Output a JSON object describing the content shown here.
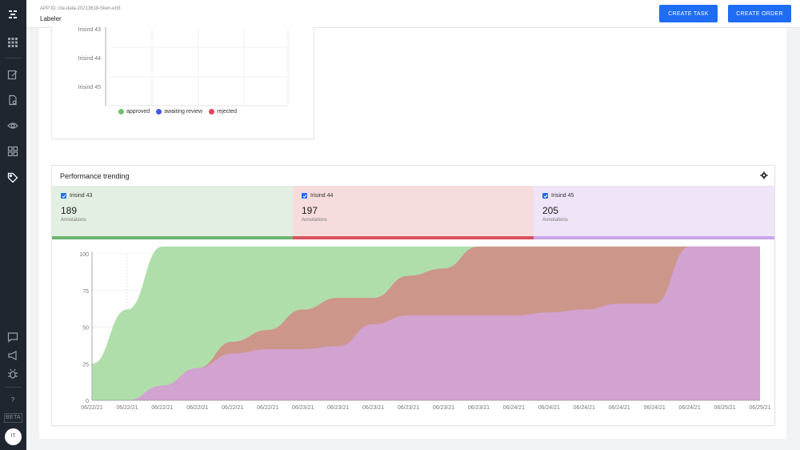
{
  "app": {
    "id_line": "APP ID: cte-data-20213618-5ken-ert3",
    "name": "Labeler"
  },
  "toolbar": {
    "create_task_label": "CREATE TASK",
    "create_order_label": "CREATE ORDER"
  },
  "sidebar": {
    "beta_label": "BETA",
    "help_label": "?",
    "avatar_initials": "IT"
  },
  "top_chart": {
    "y_labels": [
      "Irisind 43",
      "Irisind 44",
      "Irisind 45"
    ],
    "legend": [
      {
        "label": "approved",
        "color": "#6fbf73"
      },
      {
        "label": "awaiting review",
        "color": "#3d5af1"
      },
      {
        "label": "rejected",
        "color": "#e0475b"
      }
    ]
  },
  "performance": {
    "title": "Performance trending",
    "users": [
      {
        "name": "Irisind 43",
        "count": "189",
        "sublabel": "Annotations",
        "bg": "#e3efe3",
        "bar": "#6cb56f"
      },
      {
        "name": "Irisind 44",
        "count": "197",
        "sublabel": "Annotations",
        "bg": "#f6dcdd",
        "bar": "#d9515e"
      },
      {
        "name": "Irisind 45",
        "count": "205",
        "sublabel": "Annotations",
        "bg": "#efe4f8",
        "bar": "#c7a6e8"
      }
    ]
  },
  "chart_data": {
    "type": "area",
    "y_ticks": [
      "0",
      "25",
      "50",
      "75",
      "100"
    ],
    "ylim": [
      0,
      100
    ],
    "x_tick_labels": [
      "06/22/21",
      "06/22/21",
      "06/22/21",
      "06/22/21",
      "06/22/21",
      "06/22/21",
      "06/23/21",
      "06/23/21",
      "06/23/21",
      "06/23/21",
      "06/23/21",
      "06/23/21",
      "06/24/21",
      "06/24/21",
      "06/24/21",
      "06/24/21",
      "06/24/21",
      "06/24/21",
      "06/25/21",
      "06/25/21"
    ],
    "x": [
      0,
      1,
      2,
      3,
      4,
      5,
      6,
      7,
      8,
      9,
      10,
      11,
      12,
      13,
      14,
      15,
      16,
      17,
      18,
      19
    ],
    "series": [
      {
        "name": "Irisind 43",
        "color": "#a8dba3",
        "values": [
          25,
          62,
          105,
          105,
          105,
          105,
          105,
          105,
          105,
          105,
          105,
          105,
          105,
          105,
          105,
          105,
          105,
          105,
          105,
          105
        ]
      },
      {
        "name": "Irisind 44",
        "color": "#cf8f88",
        "values": [
          0,
          0,
          10,
          22,
          40,
          48,
          62,
          70,
          70,
          85,
          90,
          105,
          105,
          105,
          105,
          105,
          105,
          105,
          105,
          105
        ]
      },
      {
        "name": "Irisind 45",
        "color": "#d3a3d6",
        "values": [
          0,
          0,
          10,
          22,
          32,
          35,
          35,
          37,
          52,
          58,
          58,
          58,
          58,
          60,
          62,
          66,
          66,
          105,
          105,
          105
        ]
      }
    ]
  }
}
